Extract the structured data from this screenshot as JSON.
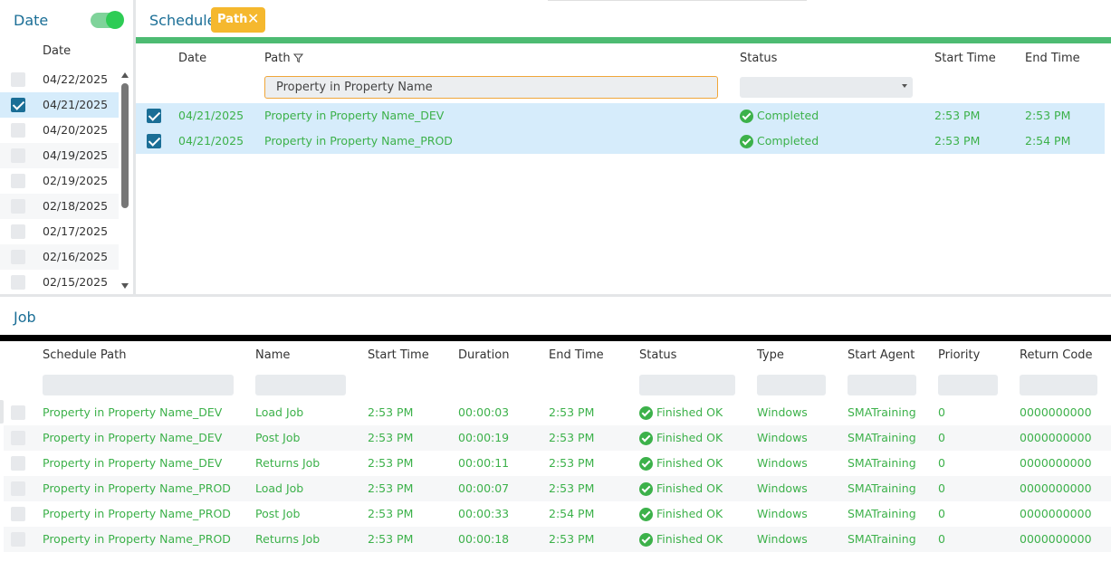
{
  "date_panel": {
    "title": "Date",
    "column_header": "Date",
    "dates": [
      {
        "label": "04/22/2025",
        "checked": false
      },
      {
        "label": "04/21/2025",
        "checked": true
      },
      {
        "label": "04/20/2025",
        "checked": false
      },
      {
        "label": "04/19/2025",
        "checked": false
      },
      {
        "label": "02/19/2025",
        "checked": false
      },
      {
        "label": "02/18/2025",
        "checked": false
      },
      {
        "label": "02/17/2025",
        "checked": false
      },
      {
        "label": "02/16/2025",
        "checked": false
      },
      {
        "label": "02/15/2025",
        "checked": false
      }
    ]
  },
  "schedule": {
    "title": "Schedule",
    "filter_chip": "Path",
    "columns": {
      "date": "Date",
      "path": "Path",
      "status": "Status",
      "start": "Start Time",
      "end": "End Time"
    },
    "path_filter_value": "Property in Property Name",
    "rows": [
      {
        "date": "04/21/2025",
        "path": "Property in Property Name_DEV",
        "status": "Completed",
        "start": "2:53 PM",
        "end": "2:53 PM"
      },
      {
        "date": "04/21/2025",
        "path": "Property in Property Name_PROD",
        "status": "Completed",
        "start": "2:53 PM",
        "end": "2:54 PM"
      }
    ]
  },
  "job": {
    "title": "Job",
    "columns": {
      "path": "Schedule Path",
      "name": "Name",
      "start": "Start Time",
      "duration": "Duration",
      "end": "End Time",
      "status": "Status",
      "type": "Type",
      "agent": "Start Agent",
      "priority": "Priority",
      "code": "Return Code"
    },
    "rows": [
      {
        "path": "Property in Property Name_DEV",
        "name": "Load Job",
        "start": "2:53 PM",
        "duration": "00:00:03",
        "end": "2:53 PM",
        "status": "Finished OK",
        "type": "Windows",
        "agent": "SMATraining",
        "priority": "0",
        "code": "0000000000"
      },
      {
        "path": "Property in Property Name_DEV",
        "name": "Post Job",
        "start": "2:53 PM",
        "duration": "00:00:19",
        "end": "2:53 PM",
        "status": "Finished OK",
        "type": "Windows",
        "agent": "SMATraining",
        "priority": "0",
        "code": "0000000000"
      },
      {
        "path": "Property in Property Name_DEV",
        "name": "Returns Job",
        "start": "2:53 PM",
        "duration": "00:00:11",
        "end": "2:53 PM",
        "status": "Finished OK",
        "type": "Windows",
        "agent": "SMATraining",
        "priority": "0",
        "code": "0000000000"
      },
      {
        "path": "Property in Property Name_PROD",
        "name": "Load Job",
        "start": "2:53 PM",
        "duration": "00:00:07",
        "end": "2:53 PM",
        "status": "Finished OK",
        "type": "Windows",
        "agent": "SMATraining",
        "priority": "0",
        "code": "0000000000"
      },
      {
        "path": "Property in Property Name_PROD",
        "name": "Post Job",
        "start": "2:53 PM",
        "duration": "00:00:33",
        "end": "2:54 PM",
        "status": "Finished OK",
        "type": "Windows",
        "agent": "SMATraining",
        "priority": "0",
        "code": "0000000000"
      },
      {
        "path": "Property in Property Name_PROD",
        "name": "Returns Job",
        "start": "2:53 PM",
        "duration": "00:00:18",
        "end": "2:53 PM",
        "status": "Finished OK",
        "type": "Windows",
        "agent": "SMATraining",
        "priority": "0",
        "code": "0000000000"
      }
    ]
  },
  "colors": {
    "accent": "#1a6e96",
    "green": "#3cb14a",
    "chip": "#f5b82e",
    "bar": "#4dbb72"
  }
}
